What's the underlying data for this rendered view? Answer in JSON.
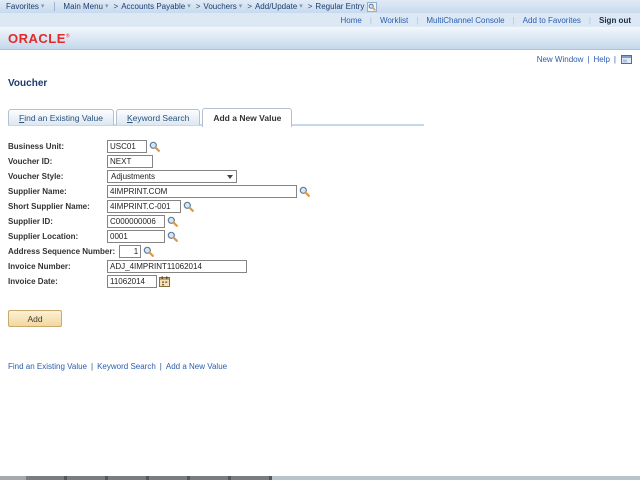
{
  "breadcrumb": {
    "items": [
      {
        "label": "Favorites",
        "caret": true
      },
      {
        "label": "Main Menu",
        "caret": true,
        "divider_before": true
      },
      {
        "label": "Accounts Payable",
        "caret": true,
        "arrow_before": true
      },
      {
        "label": "Vouchers",
        "caret": true,
        "arrow_before": true
      },
      {
        "label": "Add/Update",
        "caret": true,
        "arrow_before": true
      },
      {
        "label": "Regular Entry",
        "caret": false,
        "arrow_before": true,
        "search_icon_after": true
      }
    ]
  },
  "header": {
    "links": [
      "Home",
      "Worklist",
      "MultiChannel Console",
      "Add to Favorites"
    ],
    "sign_out": "Sign out"
  },
  "brand": {
    "name": "ORACLE",
    "mark": "®"
  },
  "page_links": {
    "new_window": "New Window",
    "help": "Help"
  },
  "page": {
    "title": "Voucher"
  },
  "tabs": [
    {
      "label": "Find an Existing Value",
      "underline_first": true,
      "active": false
    },
    {
      "label": "Keyword Search",
      "underline_first": true,
      "active": false
    },
    {
      "label": "Add a New Value",
      "underline_first": false,
      "active": true
    }
  ],
  "form": {
    "fields": [
      {
        "id": "business-unit",
        "label": "Business Unit:",
        "value": "USC01",
        "width": 40,
        "icon": "lookup"
      },
      {
        "id": "voucher-id",
        "label": "Voucher ID:",
        "value": "NEXT",
        "width": 46,
        "icon": null
      },
      {
        "id": "voucher-style",
        "label": "Voucher Style:",
        "value": "Adjustments",
        "width": 130,
        "type": "select"
      },
      {
        "id": "supplier-name",
        "label": "Supplier Name:",
        "value": "4IMPRINT.COM",
        "width": 190,
        "icon": "lookup"
      },
      {
        "id": "short-supplier-name",
        "label": "Short Supplier Name:",
        "value": "4IMPRINT.C-001",
        "width": 74,
        "icon": "lookup"
      },
      {
        "id": "supplier-id",
        "label": "Supplier ID:",
        "value": "C000000006",
        "width": 58,
        "icon": "lookup"
      },
      {
        "id": "supplier-location",
        "label": "Supplier Location:",
        "value": "0001",
        "width": 58,
        "icon": "lookup"
      },
      {
        "id": "address-sequence-number",
        "label": "Address Sequence Number:",
        "value": "1",
        "width": 22,
        "icon": "lookup",
        "align": "right"
      },
      {
        "id": "invoice-number",
        "label": "Invoice Number:",
        "value": "ADJ_4IMPRINT11062014",
        "width": 140,
        "icon": null
      },
      {
        "id": "invoice-date",
        "label": "Invoice Date:",
        "value": "11062014",
        "width": 50,
        "icon": "calendar"
      }
    ]
  },
  "actions": {
    "add_label": "Add"
  },
  "footer_links": [
    "Find an Existing Value",
    "Keyword Search",
    "Add a New Value"
  ],
  "colors": {
    "oracle_red": "#e32a28",
    "link_blue": "#2a5db0",
    "breadcrumb_navy": "#1d3e70",
    "bar_blue": "#dce9f5",
    "tab_underline": "#c5d8ee",
    "add_button_bg": "#f6e0ae",
    "add_button_border": "#c9a96e"
  }
}
